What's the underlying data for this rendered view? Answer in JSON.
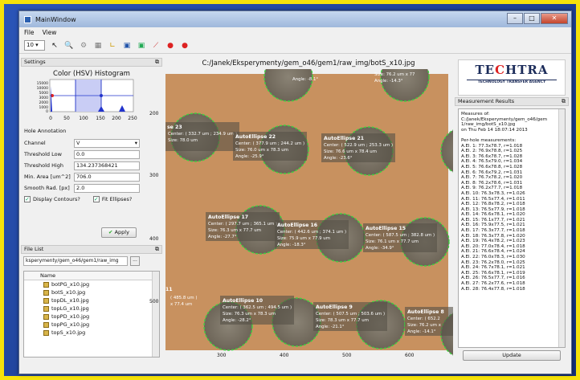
{
  "window": {
    "title": "MainWindow",
    "buttons": [
      "–",
      "□",
      "✕"
    ]
  },
  "menu": [
    "File",
    "View"
  ],
  "toolbar": {
    "zoom": "10"
  },
  "settings": {
    "title": "Settings",
    "hist_title": "Color (HSV) Histogram",
    "hist_yticks": [
      "15000",
      "10000",
      "5000",
      "3000",
      "2000",
      "1000",
      "0"
    ],
    "hist_xticks": [
      "0",
      "50",
      "100",
      "150",
      "200",
      "250"
    ],
    "hole_annotation": "Hole Annotation",
    "channel_label": "Channel",
    "channel_value": "V",
    "low_label": "Threshold Low",
    "low_value": "0.0",
    "high_label": "Threshold High",
    "high_value": "134.237368421",
    "minarea_label": "Min. Area [um^2]",
    "minarea_value": "706.0",
    "smooth_label": "Smooth Rad. [px]",
    "smooth_value": "2.0",
    "display_contours": "Display Contours?",
    "fit_ellipses": "Fit Ellipses?",
    "apply": "Apply"
  },
  "filelist": {
    "title": "File List",
    "path": "ksperymenty/gem_o46/gem1/raw_img",
    "browse": "...",
    "column": "Name",
    "files": [
      "botPG_x10.jpg",
      "botS_x10.jpg",
      "topDL_x10.jpg",
      "topLG_x10.jpg",
      "topPD_x10.jpg",
      "topPG_x10.jpg",
      "topS_x10.jpg"
    ]
  },
  "image": {
    "title": "C:/Janek/Eksperymenty/gem_o46/gem1/raw_img/botS_x10.jpg",
    "yticks": [
      "200",
      "300",
      "400",
      "500"
    ],
    "xticks": [
      "300",
      "400",
      "500",
      "600"
    ],
    "ellipses": [
      {
        "name": "",
        "center": "Center: ( 332.7 um ; 234.9 um )",
        "size": "Size: 78.0 um",
        "angle": ""
      },
      {
        "name": "AutoEllipse 22",
        "center": "Center: ( 377.9 um ; 244.2 um )",
        "size": "Size: 76.0 um x 78.3 um",
        "angle": "Angle: -25.9°"
      },
      {
        "name": "AutoEllipse 21",
        "center": "Center: ( 522.9 um ; 253.3 um )",
        "size": "Size: 76.6 um x 78.4 um",
        "angle": "Angle: -23.6°"
      },
      {
        "name": "AutoEllipse 17",
        "center": "Center: ( 297.7 um ; 365.1 um )",
        "size": "Size: 76.3 um x 77.7 um",
        "angle": "Angle: -27.7°"
      },
      {
        "name": "AutoEllipse 16",
        "center": "Center: ( 442.6 um ; 374.1 um )",
        "size": "Size: 75.9 um x 77.9 um",
        "angle": "Angle: -18.3°"
      },
      {
        "name": "AutoEllipse 15",
        "center": "Center: ( 587.5 um ; 382.8 um )",
        "size": "Size: 76.1 um x 77.7 um",
        "angle": "Angle: -34.9°"
      },
      {
        "name": "AutoEllipse 10",
        "center": "Center: ( 362.5 um ; 494.5 um )",
        "size": "Size: 76.3 um x 78.3 um",
        "angle": "Angle: -28.2°"
      },
      {
        "name": "AutoEllipse 9",
        "center": "Center: ( 507.5 um ; 503.6 um )",
        "size": "Size: 78.3 um x 77.7 um",
        "angle": "Angle: -21.1°"
      },
      {
        "name": "AutoEllipse 8",
        "center": "Center: ( 652.2",
        "size": "Size: 76.2 um x",
        "angle": "Angle: -14.1°"
      }
    ],
    "top_labels": [
      "Angle: -8.1°",
      "Size: 76.2 um x 77",
      "Angle: -14.3°"
    ],
    "edge_labels": {
      "e23": "se 23",
      "e11": "11",
      "e11c": "( 485.8 um )",
      "e11s": "x 77.4 um"
    }
  },
  "results": {
    "title": "Measurement Results",
    "logo": {
      "name_a": "TE",
      "name_b": "C",
      "name_c": "HTRA",
      "tagline": "TECHNOLOGY TRANSFER AGENCY"
    },
    "header": [
      "Measures of:",
      "C:/Janek/Eksperymenty/gem_o46/gem",
      "1/raw_img/botS_x10.jpg",
      "on Thu Feb 14 18:07:14 2013",
      "",
      "Per-hole measurements:"
    ],
    "rows": [
      "A.El. 1: 77.3x78.7, r=1.018",
      "A.El. 2: 76.9x78.8, r=1.025",
      "A.El. 3: 76.6x78.7, r=1.028",
      "A.El. 4: 76.5x79.0, r=1.034",
      "A.El. 5: 76.6x78.8, r=1.028",
      "A.El. 6: 76.6x79.2, r=1.031",
      "A.El. 7: 76.7x78.2, r=1.020",
      "A.El. 8: 76.2x78.6, r=1.031",
      "A.El. 9: 76.2x77.7, r=1.018",
      "A.El. 10: 76.3x78.3, r=1.026",
      "A.El. 11: 76.5x77.4, r=1.011",
      "A.El. 12: 76.8x78.2, r=1.018",
      "A.El. 13: 76.5x77.9, r=1.018",
      "A.El. 14: 76.6x78.1, r=1.020",
      "A.El. 15: 76.1x77.7, r=1.021",
      "A.El. 16: 75.9x77.5, r=1.021",
      "A.El. 17: 76.3x77.7, r=1.018",
      "A.El. 18: 76.3x77.8, r=1.020",
      "A.El. 19: 76.4x78.2, r=1.023",
      "A.El. 20: 77.0x78.4, r=1.018",
      "A.El. 21: 76.6x78.4, r=1.024",
      "A.El. 22: 76.0x78.3, r=1.030",
      "A.El. 23: 76.2x78.0, r=1.025",
      "A.El. 24: 76.7x78.1, r=1.021",
      "A.El. 25: 76.6x78.1, r=1.019",
      "A.El. 26: 76.5x77.7, r=1.016",
      "A.El. 27: 76.2x77.6, r=1.018",
      "A.El. 28: 76.4x77.8, r=1.018"
    ],
    "update": "Update"
  }
}
